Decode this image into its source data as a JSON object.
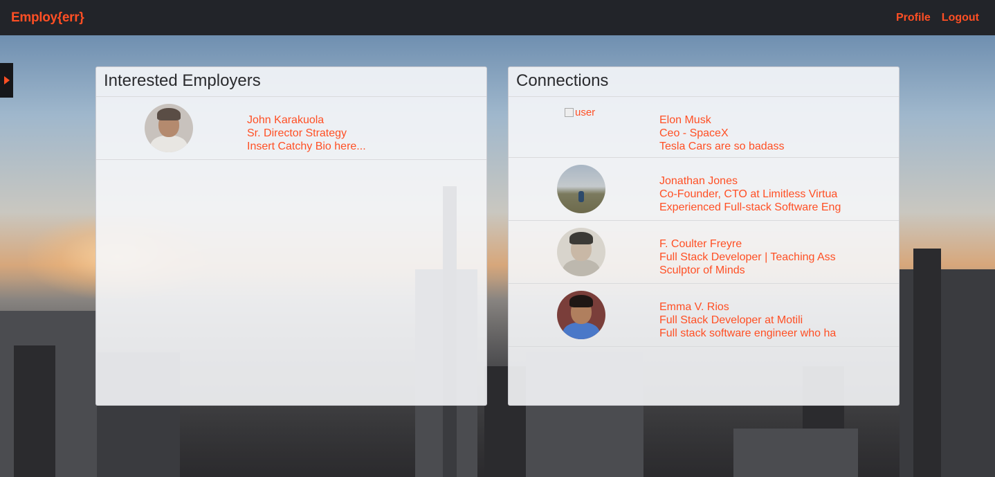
{
  "navbar": {
    "brand": "Employ{err}",
    "links": [
      {
        "label": "Profile"
      },
      {
        "label": "Logout"
      }
    ]
  },
  "colors": {
    "accent": "#ff4f24",
    "navbar_bg": "#222429"
  },
  "interested_employers": {
    "title": "Interested Employers",
    "items": [
      {
        "name": "John Karakuola",
        "title": "Sr. Director Strategy",
        "bio": "Insert Catchy Bio here..."
      }
    ]
  },
  "connections": {
    "title": "Connections",
    "items": [
      {
        "name": "Elon Musk",
        "title": "Ceo - SpaceX",
        "bio": "Tesla Cars are so badass",
        "image_alt": "user"
      },
      {
        "name": "Jonathan Jones",
        "title": "Co-Founder, CTO at Limitless Virtua",
        "bio": "Experienced Full-stack Software Eng"
      },
      {
        "name": "F. Coulter Freyre",
        "title": "Full Stack Developer | Teaching Ass",
        "bio": "Sculptor of Minds"
      },
      {
        "name": "Emma V. Rios",
        "title": "Full Stack Developer at Motili",
        "bio": "Full stack software engineer who ha"
      }
    ]
  }
}
